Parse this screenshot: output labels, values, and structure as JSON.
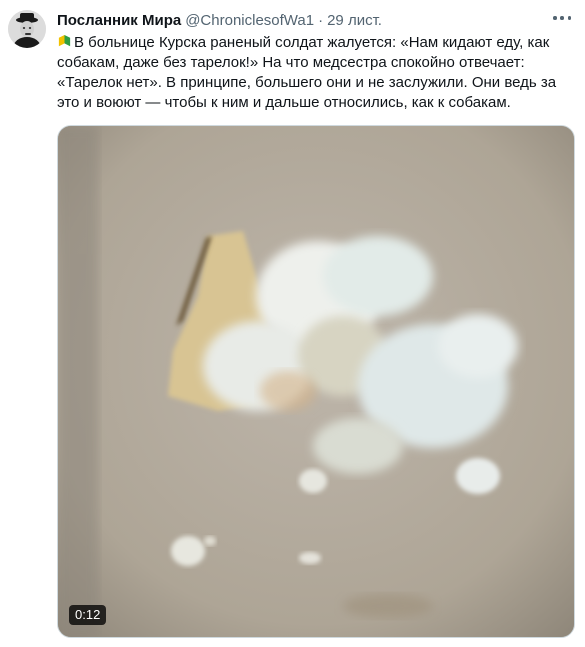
{
  "tweet": {
    "display_name": "Посланник Мира",
    "handle": "@ChroniclesofWa1",
    "separator": "·",
    "timestamp": "29 лист.",
    "avatar_icon": "avatar-icon",
    "flag_icon": "beginner-badge-icon",
    "text": "В больнице Курска раненый солдат жалуется: «Нам кидают еду, как собакам, даже без тарелок!» На что медсестра спокойно отвечает: «Тарелок нет». В принципе, большего они и не заслужили. Они ведь за это и воюют — чтобы к ним и дальше относились, как к собакам."
  },
  "media": {
    "type": "video",
    "duration": "0:12"
  },
  "colors": {
    "text_primary": "#0f1419",
    "text_secondary": "#536471",
    "border": "#cfd9de"
  }
}
